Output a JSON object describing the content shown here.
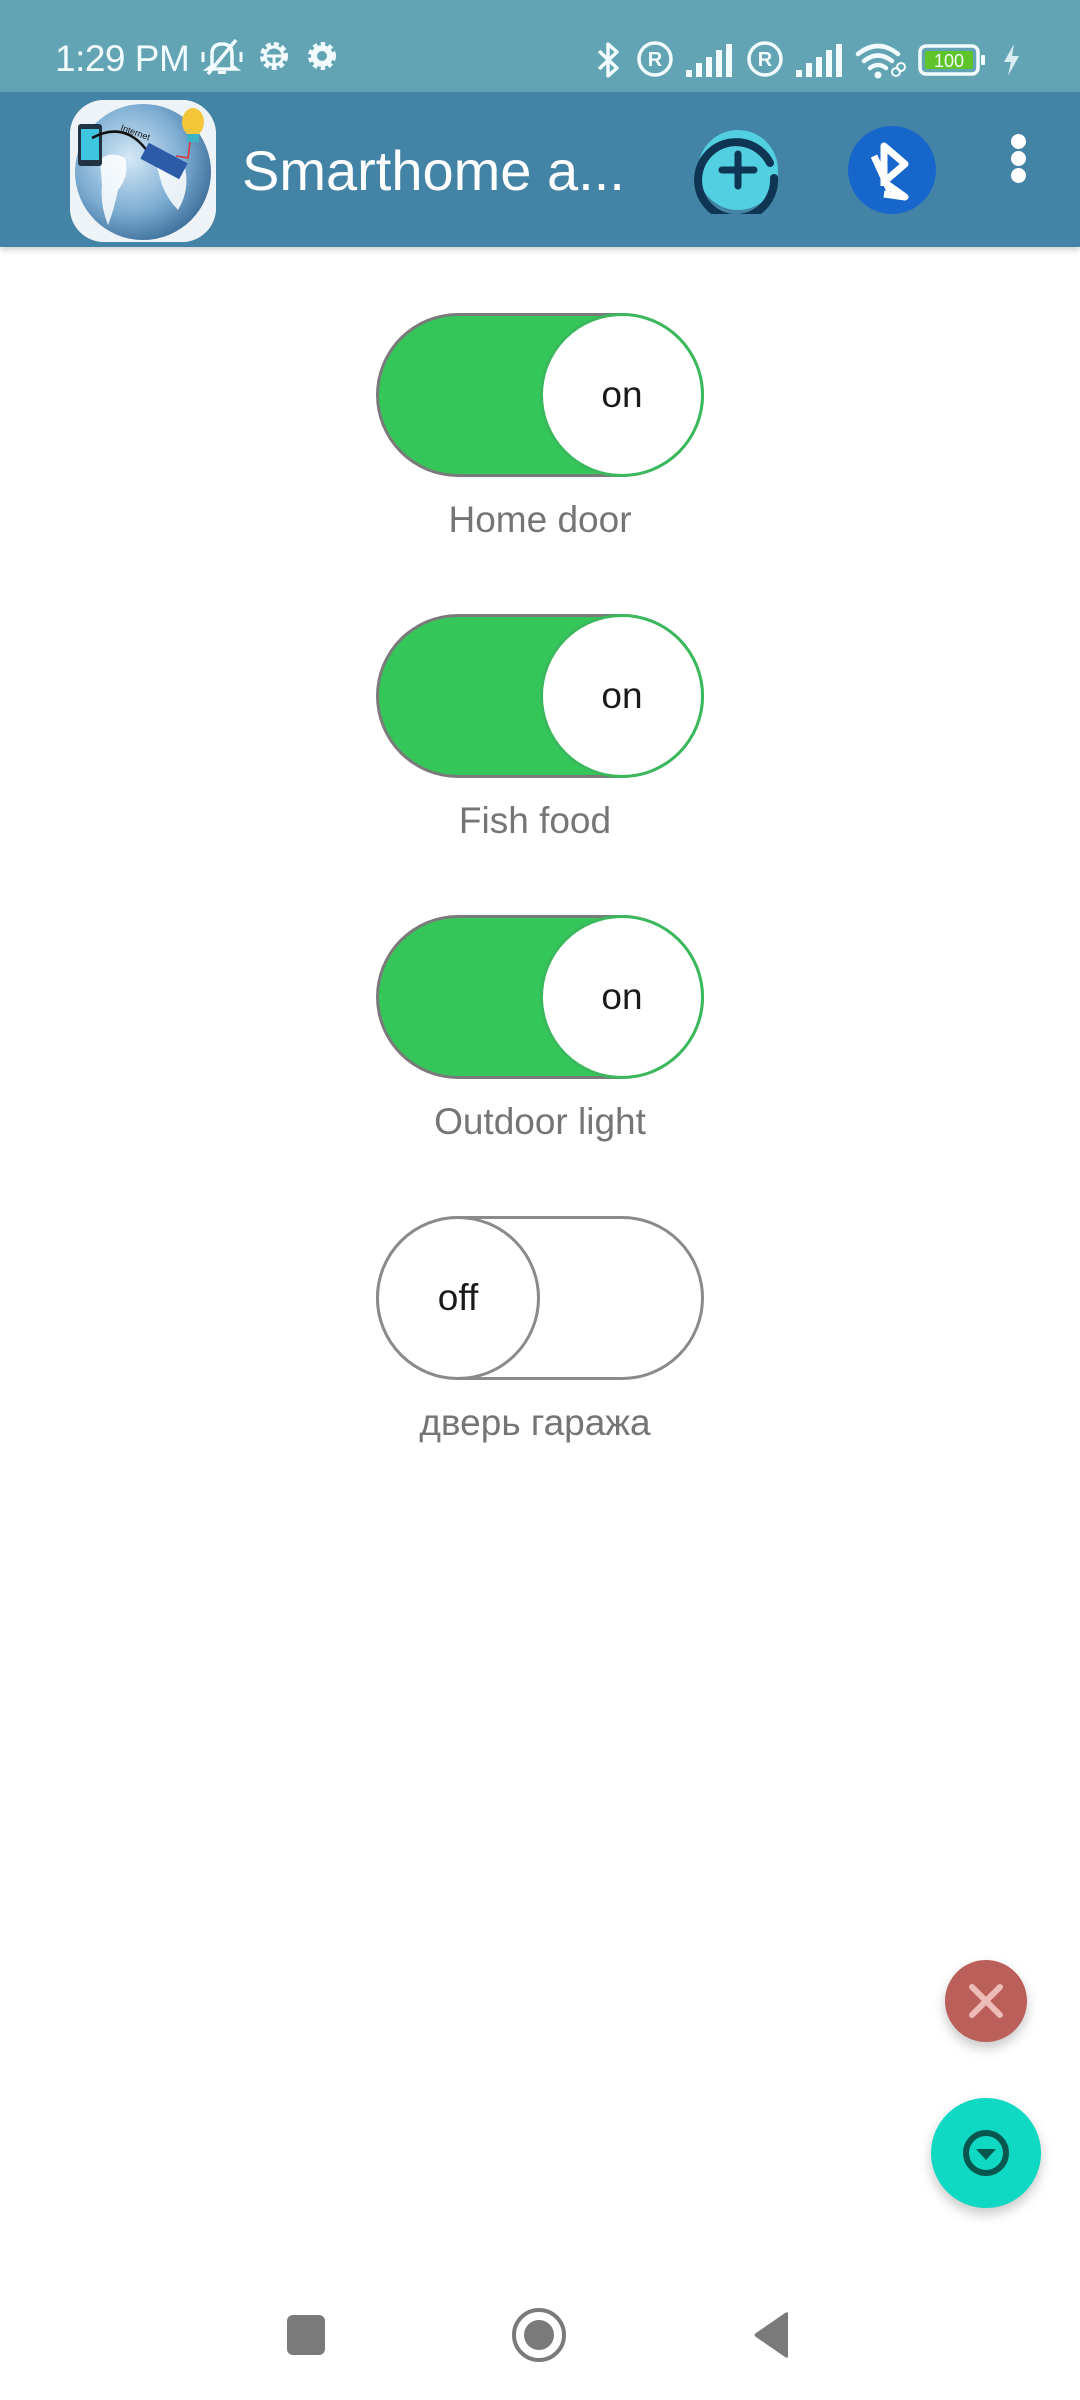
{
  "status_bar": {
    "time": "1:29 PM",
    "icons": [
      "mute-vibrate-icon",
      "android-debug-icon",
      "settings-gear-icon",
      "bluetooth-icon",
      "roaming-r-icon",
      "signal-icon",
      "roaming-r-icon",
      "signal-icon",
      "wifi-icon",
      "battery-icon",
      "charging-icon"
    ],
    "battery_level": "100",
    "battery_color": "#5ec42a"
  },
  "toolbar": {
    "title": "Smarthome a...",
    "logo_text": "Internet",
    "actions": [
      "add-icon",
      "bluetooth-icon",
      "more-vert-icon"
    ],
    "background": "#4383a6"
  },
  "switches": [
    {
      "label": "Home door",
      "state": "on",
      "state_text": "on"
    },
    {
      "label": "Fish food",
      "state": "on",
      "state_text": "on"
    },
    {
      "label": "Outdoor light",
      "state": "on",
      "state_text": "on"
    },
    {
      "label": "дверь гаража",
      "state": "off",
      "state_text": "off"
    }
  ],
  "colors": {
    "on": "#35c65a",
    "fab_close": "#bb5f5b",
    "fab_expand": "#0fd8c3"
  },
  "fabs": {
    "close_icon": "close-icon",
    "expand_icon": "arrow-drop-down-circle-icon"
  },
  "nav_bar": [
    "recents-icon",
    "home-icon",
    "back-icon"
  ]
}
